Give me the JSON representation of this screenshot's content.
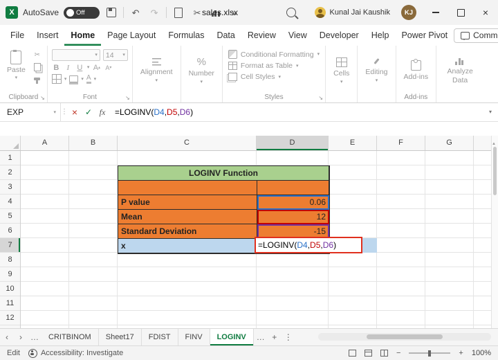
{
  "titlebar": {
    "autosave_label": "AutoSave",
    "autosave_state": "Off",
    "filename": "sales.xlsx",
    "user_name": "Kunal Jai Kaushik",
    "user_initials": "KJ"
  },
  "menubar": {
    "tabs": [
      {
        "label": "File"
      },
      {
        "label": "Insert"
      },
      {
        "label": "Home"
      },
      {
        "label": "Page Layout"
      },
      {
        "label": "Formulas"
      },
      {
        "label": "Data"
      },
      {
        "label": "Review"
      },
      {
        "label": "View"
      },
      {
        "label": "Developer"
      },
      {
        "label": "Help"
      },
      {
        "label": "Power Pivot"
      }
    ],
    "active_tab": "Home",
    "comments_label": "Comments"
  },
  "ribbon": {
    "paste_label": "Paste",
    "font_name": "",
    "font_size": "14",
    "alignment_label": "Alignment",
    "number_label": "Number",
    "conditional_formatting_label": "Conditional Formatting",
    "format_as_table_label": "Format as Table",
    "cell_styles_label": "Cell Styles",
    "cells_label": "Cells",
    "editing_label": "Editing",
    "addins_label": "Add-ins",
    "analyze_data_label": "Analyze Data",
    "group_labels": {
      "clipboard": "Clipboard",
      "font": "Font",
      "styles": "Styles",
      "addins": "Add-ins"
    }
  },
  "formula_bar": {
    "name_box_value": "EXP",
    "fx_label": "fx",
    "formula_parts": [
      {
        "text": "=LOGINV(",
        "color": "#000000"
      },
      {
        "text": "D4",
        "color": "#2970C8"
      },
      {
        "text": ",",
        "color": "#000000"
      },
      {
        "text": "D5",
        "color": "#C00000"
      },
      {
        "text": ",",
        "color": "#000000"
      },
      {
        "text": "D6",
        "color": "#7030A0"
      },
      {
        "text": ")",
        "color": "#000000"
      }
    ]
  },
  "grid": {
    "columns": [
      "A",
      "B",
      "C",
      "D",
      "E",
      "F",
      "G"
    ],
    "selected_column": "D",
    "rows": [
      "1",
      "2",
      "3",
      "4",
      "5",
      "6",
      "7",
      "8",
      "9",
      "10",
      "11",
      "12"
    ],
    "selected_row": "7",
    "table": {
      "title": "LOGINV Function",
      "items": [
        {
          "label": "P value",
          "value": "0.06",
          "ref_color": "#2970C8"
        },
        {
          "label": "Mean",
          "value": "12",
          "ref_color": "#C00000"
        },
        {
          "label": "Standard Deviation",
          "value": "-15",
          "ref_color": "#7030A0"
        }
      ],
      "result_label": "x"
    },
    "colors": {
      "title_fill": "#A9D08E",
      "data_fill": "#ED7D31",
      "result_fill": "#BDD7EE",
      "edit_border": "#E0301E",
      "accent_green": "#107C41"
    }
  },
  "sheet_tabs": {
    "tabs": [
      {
        "label": "CRITBINOM"
      },
      {
        "label": "Sheet17"
      },
      {
        "label": "FDIST"
      },
      {
        "label": "FINV"
      },
      {
        "label": "LOGINV"
      }
    ],
    "active_tab": "LOGINV"
  },
  "status_bar": {
    "mode": "Edit",
    "accessibility_label": "Accessibility: Investigate",
    "zoom_level": "100%"
  }
}
